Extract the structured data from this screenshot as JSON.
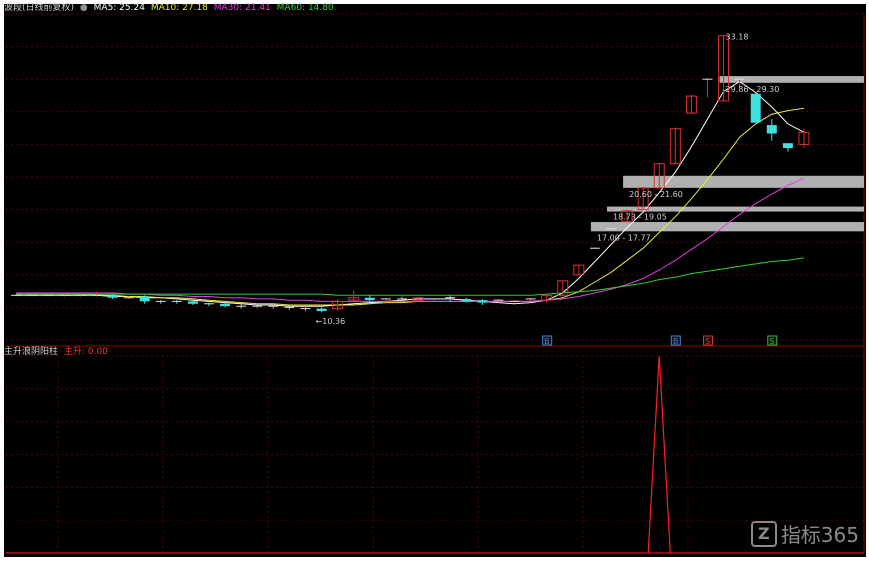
{
  "colors": {
    "background": "#000000",
    "frame": "#ffffff",
    "grid": "#5a0000",
    "up": "#e03030",
    "down": "#40e0e0",
    "ma5": "#ffffff",
    "ma10": "#e8e840",
    "ma30": "#e040e0",
    "ma60": "#30d030",
    "zone": "#b0b0b0",
    "signal": "#ff2020",
    "label": "#d0d0d0"
  },
  "main_legend": {
    "title": "波段(日线前复权)",
    "ma5": "MA5: 25.24",
    "ma10": "MA10: 27.18",
    "ma30": "MA30: 21.41",
    "ma60": "MA60: 14.80"
  },
  "sub_legend": {
    "title": "主升浪阴阳柱",
    "value": "主升: 0.00"
  },
  "markers": [
    "B",
    "B",
    "S",
    "S"
  ],
  "watermark": "指标365",
  "chart_data": [
    {
      "type": "candlestick",
      "title": "波段(日线前复权)",
      "ylim": [
        8,
        35
      ],
      "grid": true,
      "series": [
        {
          "name": "MA5",
          "values": [
            11.7,
            11.7,
            11.7,
            11.7,
            11.7,
            11.7,
            11.6,
            11.6,
            11.5,
            11.5,
            11.4,
            11.3,
            11.2,
            11.1,
            11.0,
            10.9,
            10.9,
            10.8,
            10.8,
            10.8,
            10.9,
            11.0,
            11.1,
            11.2,
            11.3,
            11.4,
            11.4,
            11.4,
            11.3,
            11.2,
            11.1,
            11.0,
            11.1,
            11.3,
            11.9,
            13.1,
            14.5,
            15.9,
            17.3,
            18.6,
            20.2,
            21.9,
            24.0,
            26.3,
            28.6,
            29.4,
            28.5,
            27.3,
            25.9,
            25.2
          ]
        },
        {
          "name": "MA10",
          "values": [
            11.8,
            11.8,
            11.8,
            11.8,
            11.8,
            11.7,
            11.7,
            11.6,
            11.6,
            11.5,
            11.5,
            11.4,
            11.3,
            11.2,
            11.1,
            11.0,
            11.0,
            10.9,
            10.9,
            10.9,
            10.9,
            10.9,
            11.0,
            11.1,
            11.1,
            11.2,
            11.2,
            11.2,
            11.2,
            11.2,
            11.2,
            11.2,
            11.2,
            11.3,
            11.5,
            12.0,
            12.8,
            13.6,
            14.6,
            15.6,
            16.9,
            18.2,
            19.7,
            21.3,
            23.0,
            24.8,
            25.9,
            26.7,
            27.0,
            27.2
          ]
        },
        {
          "name": "MA30",
          "values": [
            11.9,
            11.9,
            11.9,
            11.9,
            11.9,
            11.9,
            11.9,
            11.8,
            11.8,
            11.7,
            11.7,
            11.6,
            11.6,
            11.5,
            11.5,
            11.4,
            11.4,
            11.3,
            11.3,
            11.2,
            11.2,
            11.2,
            11.2,
            11.2,
            11.2,
            11.2,
            11.2,
            11.2,
            11.2,
            11.2,
            11.2,
            11.2,
            11.2,
            11.3,
            11.4,
            11.6,
            11.9,
            12.2,
            12.6,
            13.1,
            13.8,
            14.6,
            15.5,
            16.4,
            17.4,
            18.4,
            19.3,
            20.1,
            20.8,
            21.4
          ]
        },
        {
          "name": "MA60",
          "values": [
            11.8,
            11.8,
            11.8,
            11.8,
            11.8,
            11.8,
            11.8,
            11.8,
            11.8,
            11.8,
            11.8,
            11.8,
            11.8,
            11.8,
            11.8,
            11.8,
            11.8,
            11.8,
            11.8,
            11.8,
            11.7,
            11.7,
            11.7,
            11.7,
            11.7,
            11.7,
            11.7,
            11.7,
            11.7,
            11.7,
            11.7,
            11.7,
            11.7,
            11.8,
            11.9,
            12.0,
            12.1,
            12.3,
            12.5,
            12.7,
            13.0,
            13.2,
            13.5,
            13.7,
            13.9,
            14.1,
            14.3,
            14.5,
            14.6,
            14.8
          ]
        }
      ],
      "candles": [
        {
          "o": 11.7,
          "h": 11.8,
          "l": 11.6,
          "c": 11.7
        },
        {
          "o": 11.7,
          "h": 11.8,
          "l": 11.6,
          "c": 11.7
        },
        {
          "o": 11.7,
          "h": 11.8,
          "l": 11.6,
          "c": 11.7
        },
        {
          "o": 11.7,
          "h": 11.8,
          "l": 11.6,
          "c": 11.7
        },
        {
          "o": 11.7,
          "h": 11.8,
          "l": 11.6,
          "c": 11.7
        },
        {
          "o": 11.7,
          "h": 12.0,
          "l": 11.6,
          "c": 11.7
        },
        {
          "o": 11.7,
          "h": 11.8,
          "l": 11.4,
          "c": 11.5
        },
        {
          "o": 11.5,
          "h": 11.6,
          "l": 11.4,
          "c": 11.5
        },
        {
          "o": 11.6,
          "h": 11.7,
          "l": 11.0,
          "c": 11.2
        },
        {
          "o": 11.2,
          "h": 11.3,
          "l": 11.0,
          "c": 11.1
        },
        {
          "o": 11.2,
          "h": 11.3,
          "l": 11.0,
          "c": 11.1
        },
        {
          "o": 11.2,
          "h": 11.3,
          "l": 10.9,
          "c": 11.0
        },
        {
          "o": 11.0,
          "h": 11.1,
          "l": 10.8,
          "c": 10.9
        },
        {
          "o": 11.0,
          "h": 11.1,
          "l": 10.7,
          "c": 10.8
        },
        {
          "o": 10.8,
          "h": 11.0,
          "l": 10.6,
          "c": 10.7
        },
        {
          "o": 10.7,
          "h": 10.8,
          "l": 10.6,
          "c": 10.8
        },
        {
          "o": 10.8,
          "h": 11.0,
          "l": 10.6,
          "c": 10.7
        },
        {
          "o": 10.7,
          "h": 10.8,
          "l": 10.5,
          "c": 10.6
        },
        {
          "o": 10.6,
          "h": 10.7,
          "l": 10.4,
          "c": 10.5
        },
        {
          "o": 10.6,
          "h": 10.7,
          "l": 10.3,
          "c": 10.4
        },
        {
          "o": 10.6,
          "h": 11.4,
          "l": 10.4,
          "c": 11.2
        },
        {
          "o": 11.3,
          "h": 12.1,
          "l": 11.2,
          "c": 11.5
        },
        {
          "o": 11.5,
          "h": 11.7,
          "l": 11.2,
          "c": 11.3
        },
        {
          "o": 11.3,
          "h": 11.5,
          "l": 11.2,
          "c": 11.4
        },
        {
          "o": 11.4,
          "h": 11.6,
          "l": 11.2,
          "c": 11.3
        },
        {
          "o": 11.3,
          "h": 11.6,
          "l": 11.2,
          "c": 11.5
        },
        {
          "o": 11.4,
          "h": 11.5,
          "l": 11.3,
          "c": 11.4
        },
        {
          "o": 11.5,
          "h": 11.7,
          "l": 11.2,
          "c": 11.4
        },
        {
          "o": 11.4,
          "h": 11.5,
          "l": 11.1,
          "c": 11.2
        },
        {
          "o": 11.3,
          "h": 11.4,
          "l": 10.9,
          "c": 11.1
        },
        {
          "o": 11.2,
          "h": 11.4,
          "l": 11.1,
          "c": 11.3
        },
        {
          "o": 11.2,
          "h": 11.3,
          "l": 11.1,
          "c": 11.2
        },
        {
          "o": 11.3,
          "h": 11.5,
          "l": 11.2,
          "c": 11.4
        },
        {
          "o": 11.3,
          "h": 11.8,
          "l": 11.1,
          "c": 11.7
        },
        {
          "o": 11.7,
          "h": 12.9,
          "l": 11.7,
          "c": 12.9
        },
        {
          "o": 13.4,
          "h": 14.2,
          "l": 13.4,
          "c": 14.2
        },
        {
          "o": 15.6,
          "h": 15.7,
          "l": 15.6,
          "c": 15.6
        },
        {
          "o": 17.2,
          "h": 17.2,
          "l": 17.1,
          "c": 17.1
        },
        {
          "o": 17.8,
          "h": 18.8,
          "l": 17.8,
          "c": 18.7
        },
        {
          "o": 18.8,
          "h": 20.7,
          "l": 18.8,
          "c": 20.6
        },
        {
          "o": 20.6,
          "h": 22.6,
          "l": 20.6,
          "c": 22.6
        },
        {
          "o": 22.6,
          "h": 25.6,
          "l": 22.6,
          "c": 25.5
        },
        {
          "o": 26.8,
          "h": 28.3,
          "l": 26.8,
          "c": 28.2
        },
        {
          "o": 29.6,
          "h": 29.7,
          "l": 28.1,
          "c": 29.6
        },
        {
          "o": 27.8,
          "h": 33.2,
          "l": 27.8,
          "c": 33.2
        },
        {
          "o": 29.6,
          "h": 29.6,
          "l": 28.9,
          "c": 29.6
        },
        {
          "o": 28.4,
          "h": 28.4,
          "l": 26.0,
          "c": 26.0
        },
        {
          "o": 25.8,
          "h": 26.3,
          "l": 24.5,
          "c": 25.1
        },
        {
          "o": 24.3,
          "h": 24.3,
          "l": 23.6,
          "c": 23.9
        },
        {
          "o": 24.2,
          "h": 25.5,
          "l": 23.9,
          "c": 25.2
        }
      ],
      "labels": [
        "33.18",
        "29.86 - 29.30",
        "20.60 - 21.60",
        "18.73 - 19.05",
        "17.00 - 17.77",
        "10.36"
      ],
      "zones": [
        {
          "label": "29.86 - 29.30",
          "low": 29.3,
          "high": 29.86,
          "from": 44
        },
        {
          "label": "20.60 - 21.60",
          "low": 20.6,
          "high": 21.6,
          "from": 38
        },
        {
          "label": "18.73 - 19.05",
          "low": 18.73,
          "high": 19.05,
          "from": 37
        },
        {
          "label": "17.00 - 17.77",
          "low": 17.0,
          "high": 17.77,
          "from": 36
        }
      ]
    },
    {
      "type": "line",
      "title": "主升浪阴阳柱",
      "series": [
        {
          "name": "主升",
          "values": [
            0,
            0,
            0,
            0,
            0,
            0,
            0,
            0,
            0,
            0,
            0,
            0,
            0,
            0,
            0,
            0,
            0,
            0,
            0,
            0,
            0,
            0,
            0,
            0,
            0,
            0,
            0,
            0,
            0,
            0,
            0,
            0,
            0,
            0,
            0,
            0,
            0,
            0,
            0,
            0,
            1,
            0,
            0,
            0,
            0,
            0,
            0,
            0,
            0,
            0
          ]
        }
      ]
    }
  ]
}
